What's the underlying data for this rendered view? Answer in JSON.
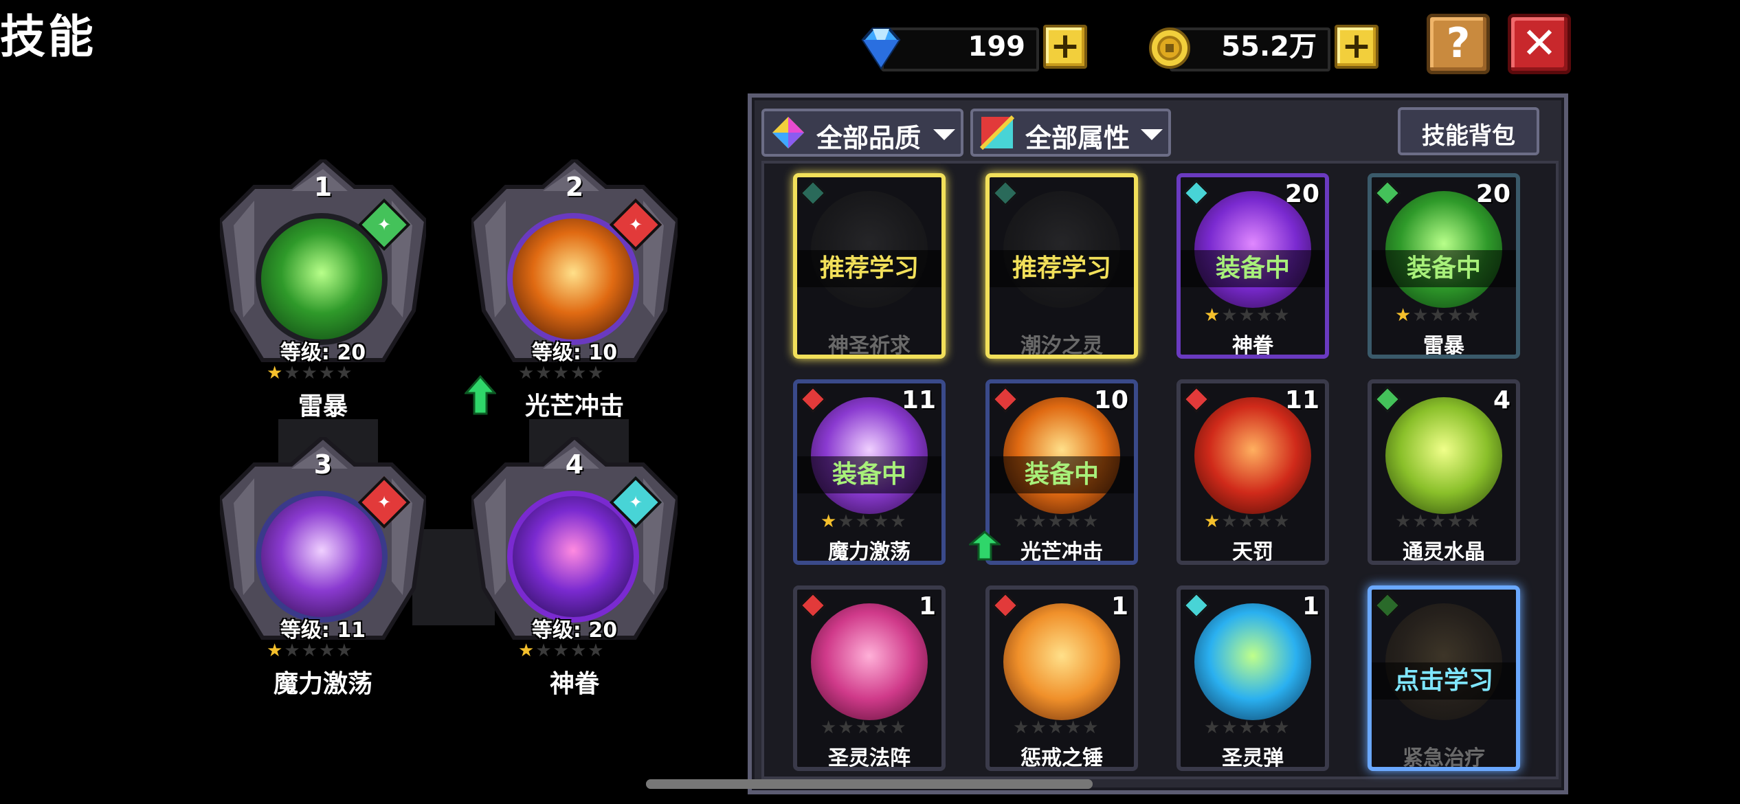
{
  "header": {
    "title": "技能"
  },
  "currency": {
    "diamond": {
      "value": "199",
      "icon": "diamond-icon",
      "color": "#3fa8ff"
    },
    "coin": {
      "value": "55.2万",
      "icon": "coin-icon",
      "color": "#f2cf3c"
    }
  },
  "buttons": {
    "help": "?",
    "close": "✕"
  },
  "equipped": [
    {
      "slot": "1",
      "level": "等级: 20",
      "name": "雷暴",
      "stars": 1,
      "element": "wind",
      "gem_color": "#44c25a"
    },
    {
      "slot": "2",
      "level": "等级: 10",
      "name": "光芒冲击",
      "stars": 0,
      "element": "fire",
      "gem_color": "#e23a3a"
    },
    {
      "slot": "3",
      "level": "等级: 11",
      "name": "魔力激荡",
      "stars": 1,
      "element": "fire",
      "gem_color": "#e23a3a"
    },
    {
      "slot": "4",
      "level": "等级: 20",
      "name": "神眷",
      "stars": 1,
      "element": "water",
      "gem_color": "#48d4d6"
    }
  ],
  "filters": {
    "quality": "全部品质",
    "attribute": "全部属性",
    "bag": "技能背包"
  },
  "skills": [
    {
      "name": "神圣祈求",
      "tag": "推荐学习",
      "level": "",
      "stars": null,
      "state": "recommend"
    },
    {
      "name": "潮汐之灵",
      "tag": "推荐学习",
      "level": "",
      "stars": null,
      "state": "recommend"
    },
    {
      "name": "神眷",
      "tag": "装备中",
      "level": "20",
      "stars": 1,
      "state": "equipped"
    },
    {
      "name": "雷暴",
      "tag": "装备中",
      "level": "20",
      "stars": 1,
      "state": "equipped"
    },
    {
      "name": "魔力激荡",
      "tag": "装备中",
      "level": "11",
      "stars": 1,
      "state": "equipped"
    },
    {
      "name": "光芒冲击",
      "tag": "装备中",
      "level": "10",
      "stars": 0,
      "state": "equipped"
    },
    {
      "name": "天罚",
      "tag": "",
      "level": "11",
      "stars": 1,
      "state": "owned"
    },
    {
      "name": "通灵水晶",
      "tag": "",
      "level": "4",
      "stars": 0,
      "state": "owned"
    },
    {
      "name": "圣灵法阵",
      "tag": "",
      "level": "1",
      "stars": 0,
      "state": "owned"
    },
    {
      "name": "惩戒之锤",
      "tag": "",
      "level": "1",
      "stars": 0,
      "state": "owned"
    },
    {
      "name": "圣灵弹",
      "tag": "",
      "level": "1",
      "stars": 0,
      "state": "owned"
    },
    {
      "name": "紧急治疗",
      "tag": "点击学习",
      "level": "",
      "stars": null,
      "state": "learn"
    }
  ],
  "colors": {
    "accent_yellow": "#f2cf3c",
    "equipped_text": "#a8f07a",
    "learn_text": "#7fe6ff",
    "panel": "#2a2a34"
  }
}
